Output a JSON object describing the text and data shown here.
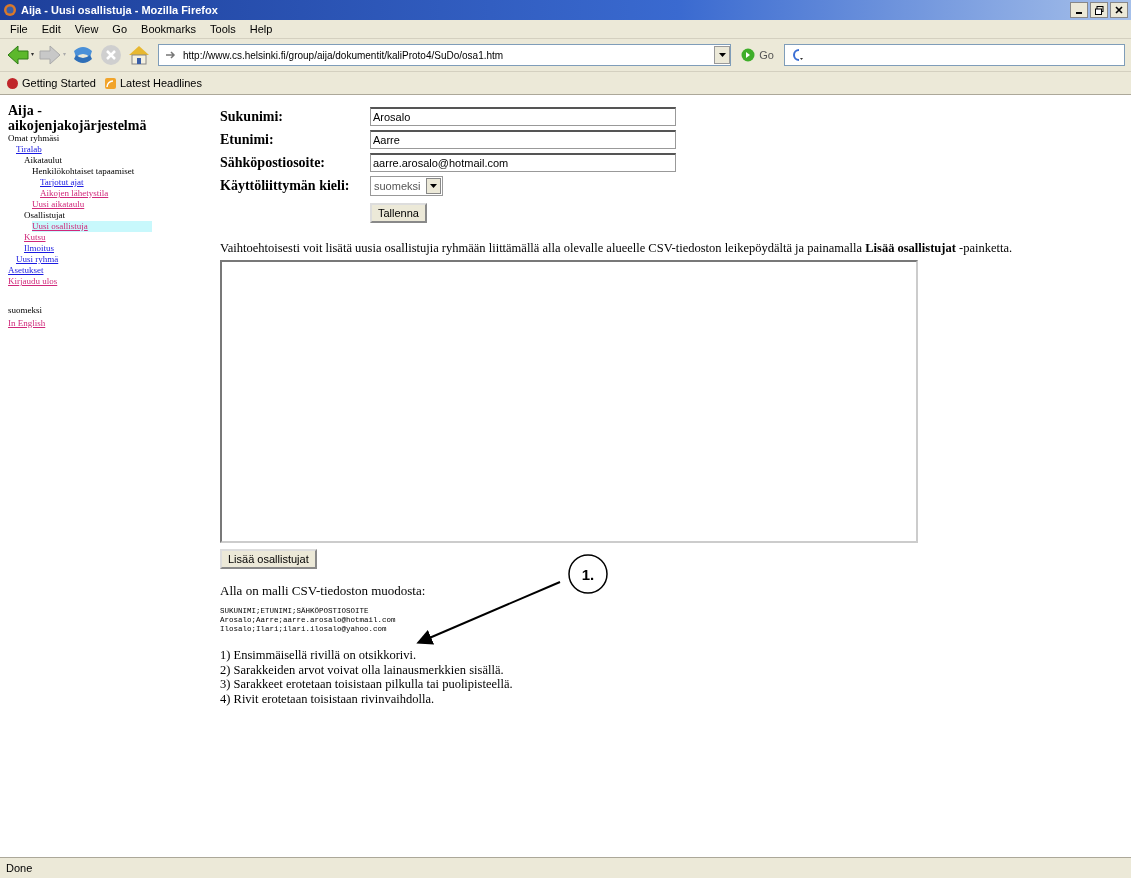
{
  "window": {
    "title": "Aija - Uusi osallistuja - Mozilla Firefox"
  },
  "menu": [
    "File",
    "Edit",
    "View",
    "Go",
    "Bookmarks",
    "Tools",
    "Help"
  ],
  "address_bar": {
    "value": "http://www.cs.helsinki.fi/group/aija/dokumentit/kaliProto4/SuDo/osa1.htm",
    "go_label": "Go"
  },
  "bookmarks": [
    "Getting Started",
    "Latest Headlines"
  ],
  "sidebar": {
    "title": "Aija - aikojenjakojärjestelmä",
    "tree": [
      {
        "kind": "heading",
        "label": "Omat ryhmäsi",
        "children": [
          {
            "kind": "link",
            "label": "Tiralab",
            "visited": false,
            "selected": false,
            "children": [
              {
                "kind": "heading",
                "label": "Aikataulut",
                "children": [
                  {
                    "kind": "heading",
                    "label": "Henkilökohtaiset tapaamiset",
                    "children": [
                      {
                        "kind": "link",
                        "label": "Tarjotut ajat",
                        "visited": false,
                        "selected": false
                      },
                      {
                        "kind": "link",
                        "label": "Aikojen lähetystila",
                        "visited": true,
                        "selected": false
                      }
                    ]
                  },
                  {
                    "kind": "link",
                    "label": "Uusi aikataulu",
                    "visited": true,
                    "selected": false
                  }
                ]
              },
              {
                "kind": "heading",
                "label": "Osallistujat",
                "children": [
                  {
                    "kind": "link",
                    "label": "Uusi osallistuja",
                    "visited": true,
                    "selected": true
                  }
                ]
              },
              {
                "kind": "link",
                "label": "Kutsu",
                "visited": true,
                "selected": false
              },
              {
                "kind": "link",
                "label": "Ilmoitus",
                "visited": false,
                "selected": false
              }
            ]
          },
          {
            "kind": "link",
            "label": "Uusi ryhmä",
            "visited": false,
            "selected": false
          }
        ]
      },
      {
        "kind": "link",
        "label": "Asetukset",
        "visited": false,
        "selected": false
      },
      {
        "kind": "link",
        "label": "Kirjaudu ulos",
        "visited": true,
        "selected": false
      }
    ],
    "languages": [
      {
        "kind": "heading",
        "label": "suomeksi"
      },
      {
        "kind": "link",
        "label": "In English",
        "visited": true,
        "selected": false
      }
    ]
  },
  "form": {
    "fields": [
      {
        "kind": "text",
        "label": "Sukunimi:",
        "value": "Arosalo"
      },
      {
        "kind": "text",
        "label": "Etunimi:",
        "value": "Aarre"
      },
      {
        "kind": "text",
        "label": "Sähköpostiosoite:",
        "value": "aarre.arosalo@hotmail.com"
      },
      {
        "kind": "select",
        "label": "Käyttöliittymän kieli:",
        "value": "suomeksi"
      }
    ],
    "save_button": "Tallenna"
  },
  "instructions": "Vaihtoehtoisesti voit lisätä uusia osallistujia ryhmään liittämällä alla olevalle alueelle CSV-tiedoston leikepöydältä ja painamalla **Lisää osallistujat** -painketta.",
  "add_button": "Lisää osallistujat",
  "sample_title": "Alla on malli CSV-tiedoston muodosta:",
  "sample_lines": [
    "SUKUNIMI;ETUNIMI;SÄHKÖPOSTIOSOITE",
    "Arosalo;Aarre;aarre.arosalo@hotmail.com",
    "Ilosalo;Ilari;ilari.ilosalo@yahoo.com"
  ],
  "rules": [
    "1) Ensimmäisellä rivillä on otsikkorivi.",
    "2) Sarakkeiden arvot voivat olla lainausmerkkien sisällä.",
    "3) Sarakkeet erotetaan toisistaan pilkulla tai puolipisteellä.",
    "4) Rivit erotetaan toisistaan rivinvaihdolla."
  ],
  "callout": {
    "label": "1."
  },
  "status_bar": "Done"
}
